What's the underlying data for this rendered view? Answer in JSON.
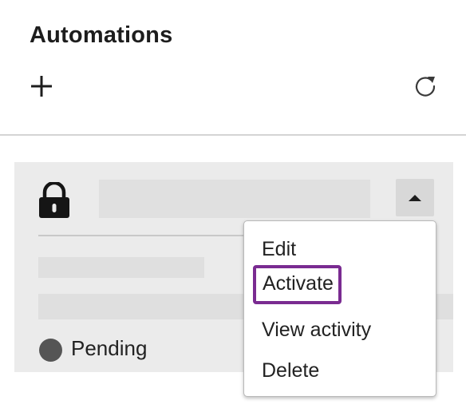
{
  "header": {
    "title": "Automations",
    "add_icon": "plus-icon",
    "refresh_icon": "refresh-icon"
  },
  "card": {
    "lock_icon": "lock-icon",
    "toggle_icon": "caret-up-icon",
    "status": {
      "label": "Pending",
      "color": "#555555"
    }
  },
  "menu": {
    "items": [
      {
        "label": "Edit"
      },
      {
        "label": "Activate",
        "focused": true
      },
      {
        "label": "View activity"
      },
      {
        "label": "Delete"
      }
    ],
    "focus_color": "#7a2b91"
  }
}
